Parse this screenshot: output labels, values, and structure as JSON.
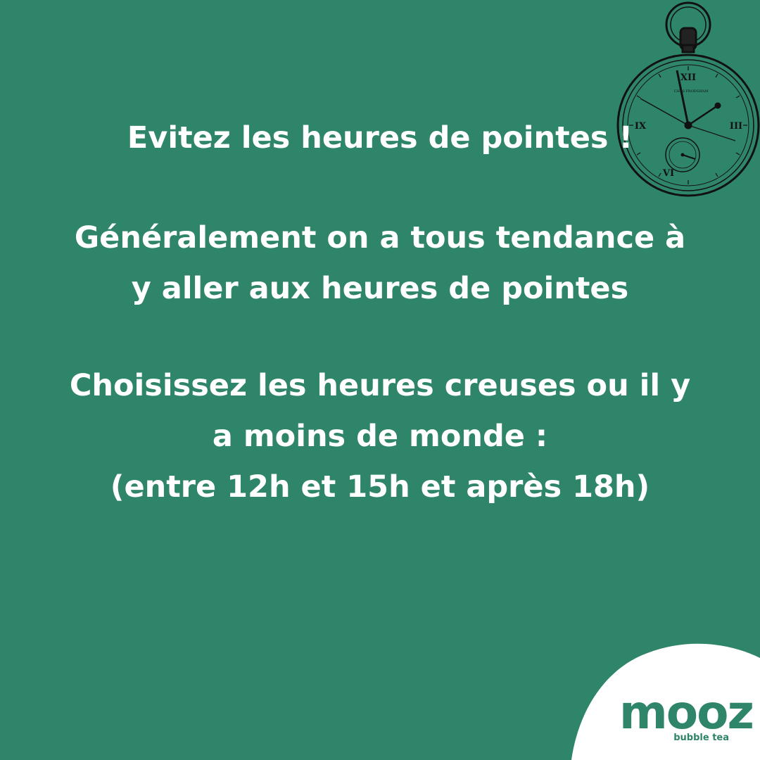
{
  "colors": {
    "background": "#2f856a",
    "text": "#ffffff",
    "corner_blob": "#ffffff",
    "brand": "#2f856a"
  },
  "heading": "Evitez les heures de pointes !",
  "paragraph1": {
    "lines": [
      "Généralement on a tous tendance à",
      "y aller aux heures de pointes"
    ]
  },
  "paragraph2": {
    "lines": [
      "Choisissez les heures creuses ou il y",
      "a moins de monde :",
      "(entre 12h et 15h et après 18h)"
    ]
  },
  "watch": {
    "icon": "pocket-watch-icon",
    "maker_text": "CHAS FRODSHAM",
    "numerals": [
      "XII",
      "III",
      "VI",
      "IX"
    ]
  },
  "logo": {
    "wordmark": "mooz",
    "tagline": "bubble tea"
  }
}
